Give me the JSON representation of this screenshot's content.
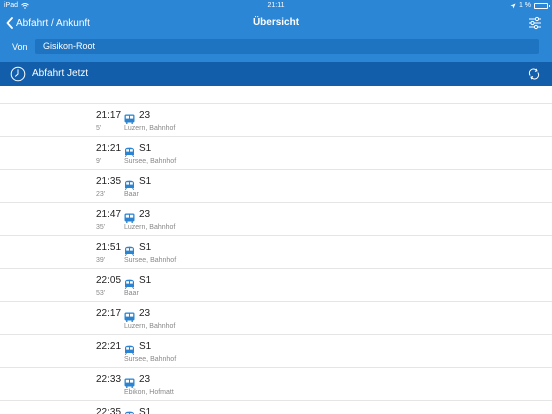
{
  "status_bar": {
    "device": "iPad",
    "time": "21:11",
    "battery": "1 %"
  },
  "nav": {
    "back_label": "Abfahrt / Ankunft",
    "title": "Übersicht"
  },
  "from": {
    "label": "Von",
    "value": "Gisikon-Root"
  },
  "departure_bar": {
    "label": "Abfahrt Jetzt"
  },
  "colors": {
    "header": "#2b86d6",
    "departure_bar": "#135eab",
    "input": "#1f74c2",
    "icon": "#2a84d2"
  },
  "departures": [
    {
      "time": "21:17",
      "minutes": "5'",
      "type": "bus",
      "line": "23",
      "destination": "Luzern, Bahnhof"
    },
    {
      "time": "21:21",
      "minutes": "9'",
      "type": "train",
      "line": "S1",
      "destination": "Sursee, Bahnhof"
    },
    {
      "time": "21:35",
      "minutes": "23'",
      "type": "train",
      "line": "S1",
      "destination": "Baar"
    },
    {
      "time": "21:47",
      "minutes": "35'",
      "type": "bus",
      "line": "23",
      "destination": "Luzern, Bahnhof"
    },
    {
      "time": "21:51",
      "minutes": "39'",
      "type": "train",
      "line": "S1",
      "destination": "Sursee, Bahnhof"
    },
    {
      "time": "22:05",
      "minutes": "53'",
      "type": "train",
      "line": "S1",
      "destination": "Baar"
    },
    {
      "time": "22:17",
      "minutes": "",
      "type": "bus",
      "line": "23",
      "destination": "Luzern, Bahnhof"
    },
    {
      "time": "22:21",
      "minutes": "",
      "type": "train",
      "line": "S1",
      "destination": "Sursee, Bahnhof"
    },
    {
      "time": "22:33",
      "minutes": "",
      "type": "bus",
      "line": "23",
      "destination": "Ebikon, Hofmatt"
    },
    {
      "time": "22:35",
      "minutes": "",
      "type": "train",
      "line": "S1",
      "destination": ""
    }
  ]
}
